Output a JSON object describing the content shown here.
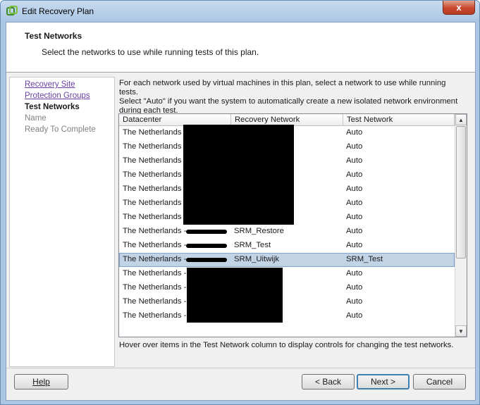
{
  "window": {
    "title": "Edit Recovery Plan",
    "close_glyph": "x"
  },
  "header": {
    "title": "Test Networks",
    "subtitle": "Select the networks to use while running tests of this plan."
  },
  "steps": [
    {
      "label": "Recovery Site",
      "state": "link"
    },
    {
      "label": "Protection Groups",
      "state": "link"
    },
    {
      "label": "Test Networks",
      "state": "current"
    },
    {
      "label": "Name",
      "state": "disabled"
    },
    {
      "label": "Ready To Complete",
      "state": "disabled"
    }
  ],
  "main": {
    "instructions_line1": "For each network used by virtual machines in this plan, select a network to use while running tests.",
    "instructions_line2": "Select \"Auto\" if you want the system to automatically create a new isolated network environment",
    "instructions_line3": "during each test.",
    "hover_note": "Hover over items in the Test Network column to display controls for changing the test networks."
  },
  "table": {
    "columns": [
      "Datacenter",
      "Recovery Network",
      "Test Network"
    ],
    "rows": [
      {
        "datacenter": "The Netherlands",
        "recovery": "",
        "test": "Auto"
      },
      {
        "datacenter": "The Netherlands",
        "recovery": "",
        "test": "Auto"
      },
      {
        "datacenter": "The Netherlands",
        "recovery": "",
        "test": "Auto"
      },
      {
        "datacenter": "The Netherlands",
        "recovery": "",
        "test": "Auto"
      },
      {
        "datacenter": "The Netherlands",
        "recovery": "",
        "test": "Auto"
      },
      {
        "datacenter": "The Netherlands",
        "recovery": "",
        "test": "Auto"
      },
      {
        "datacenter": "The Netherlands",
        "recovery": "",
        "test": "Auto"
      },
      {
        "datacenter": "The Netherlands -",
        "recovery": "SRM_Restore",
        "test": "Auto"
      },
      {
        "datacenter": "The Netherlands -",
        "recovery": "SRM_Test",
        "test": "Auto"
      },
      {
        "datacenter": "The Netherlands -",
        "recovery": "SRM_Uitwijk",
        "test": "SRM_Test",
        "selected": true
      },
      {
        "datacenter": "The Netherlands -",
        "recovery": "",
        "test": "Auto"
      },
      {
        "datacenter": "The Netherlands -",
        "recovery": "",
        "test": "Auto"
      },
      {
        "datacenter": "The Netherlands -",
        "recovery": "",
        "test": "Auto"
      },
      {
        "datacenter": "The Netherlands -",
        "recovery": "",
        "test": "Auto"
      }
    ]
  },
  "buttons": {
    "help": "Help",
    "back": "< Back",
    "next": "Next >",
    "cancel": "Cancel"
  },
  "icons": {
    "app": "vsphere-icon",
    "scroll_up": "▲",
    "scroll_down": "▼"
  }
}
